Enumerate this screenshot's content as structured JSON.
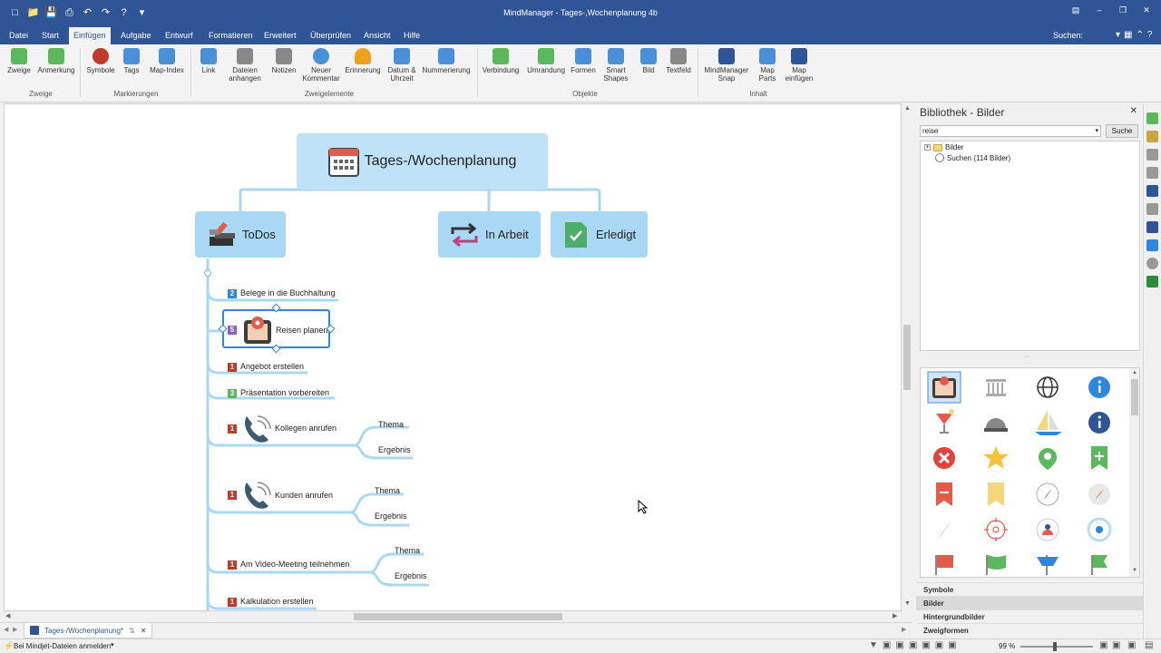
{
  "window": {
    "title": "MindManager - Tages-,Wochenplanung 4b"
  },
  "tabs": [
    {
      "label": "Datei"
    },
    {
      "label": "Start"
    },
    {
      "label": "Einfügen"
    },
    {
      "label": "Aufgabe"
    },
    {
      "label": "Entwurf"
    },
    {
      "label": "Formatieren"
    },
    {
      "label": "Erweitert"
    },
    {
      "label": "Überprüfen"
    },
    {
      "label": "Ansicht"
    },
    {
      "label": "Hilfe"
    }
  ],
  "active_tab": "Einfügen",
  "search_label": "Suchen:",
  "ribbon": {
    "buttons": [
      {
        "l1": "Zweige",
        "l2": "",
        "color": "#5cb85c"
      },
      {
        "l1": "Anmerkung",
        "l2": "",
        "color": "#5cb85c"
      },
      {
        "l1": "Symbole",
        "l2": "",
        "color": "#c0392b"
      },
      {
        "l1": "Tags",
        "l2": "",
        "color": "#4a90d9"
      },
      {
        "l1": "Map-Index",
        "l2": "",
        "color": "#4a90d9"
      },
      {
        "l1": "Link",
        "l2": "",
        "color": "#4a90d9"
      },
      {
        "l1": "Dateien",
        "l2": "anhangen",
        "color": "#888888"
      },
      {
        "l1": "Notizen",
        "l2": "",
        "color": "#888888"
      },
      {
        "l1": "Neuer",
        "l2": "Kommentar",
        "color": "#4a90d9"
      },
      {
        "l1": "Erinnerung",
        "l2": "",
        "color": "#f0a020"
      },
      {
        "l1": "Datum &",
        "l2": "Uhrzeit",
        "color": "#4a90d9"
      },
      {
        "l1": "Nummerierung",
        "l2": "",
        "color": "#4a90d9"
      },
      {
        "l1": "Verbindung",
        "l2": "",
        "color": "#5cb85c"
      },
      {
        "l1": "Umrandung",
        "l2": "",
        "color": "#5cb85c"
      },
      {
        "l1": "Formen",
        "l2": "",
        "color": "#4a90d9"
      },
      {
        "l1": "Smart",
        "l2": "Shapes",
        "color": "#4a90d9"
      },
      {
        "l1": "Bild",
        "l2": "",
        "color": "#4a90d9"
      },
      {
        "l1": "Textfeld",
        "l2": "",
        "color": "#888888"
      },
      {
        "l1": "MindManager",
        "l2": "Snap",
        "color": "#2f5597"
      },
      {
        "l1": "Map",
        "l2": "Parts",
        "color": "#4a90d9"
      },
      {
        "l1": "Map",
        "l2": "einfügen",
        "color": "#2f5597"
      }
    ],
    "groups": [
      "Zweige",
      "Markierungen",
      "Zweigelemente",
      "Objekte",
      "Inhalt"
    ]
  },
  "map": {
    "central": "Tages-/Wochenplanung",
    "main": [
      "ToDos",
      "In Arbeit",
      "Erledigt"
    ],
    "subtopics": [
      {
        "prio": "2",
        "label": "Belege in die Buchhaltung",
        "color": "#2e86de"
      },
      {
        "prio": "5",
        "label": "Reisen planen",
        "color": "#8e5ec8"
      },
      {
        "prio": "1",
        "label": "Angebot erstellen",
        "color": "#c0392b"
      },
      {
        "prio": "3",
        "label": "Präsentation vorbereiten",
        "color": "#5cb85c"
      },
      {
        "prio": "1",
        "label": "Kollegen anrufen",
        "color": "#c0392b"
      },
      {
        "prio": "1",
        "label": "Kunden anrufen",
        "color": "#c0392b"
      },
      {
        "prio": "1",
        "label": "Am Video-Meeting teilnehmen",
        "color": "#c0392b"
      },
      {
        "prio": "1",
        "label": "Kalkulation erstellen",
        "color": "#c0392b"
      }
    ],
    "leaf_thema": "Thema",
    "leaf_ergebnis": "Ergebnis"
  },
  "doc_tab": "Tages-/Wochenplanung*",
  "status": {
    "left": "Bei Mindjet-Dateien anmelden",
    "zoom": "99 %"
  },
  "library": {
    "title": "Bibliothek - Bilder",
    "search_value": "reise",
    "search_button": "Suche",
    "tree_root": "Bilder",
    "tree_search": "Suchen (114 Bilder)",
    "sections": [
      "Symbole",
      "Bilder",
      "Hintergrundbilder",
      "Zweigformen"
    ]
  }
}
